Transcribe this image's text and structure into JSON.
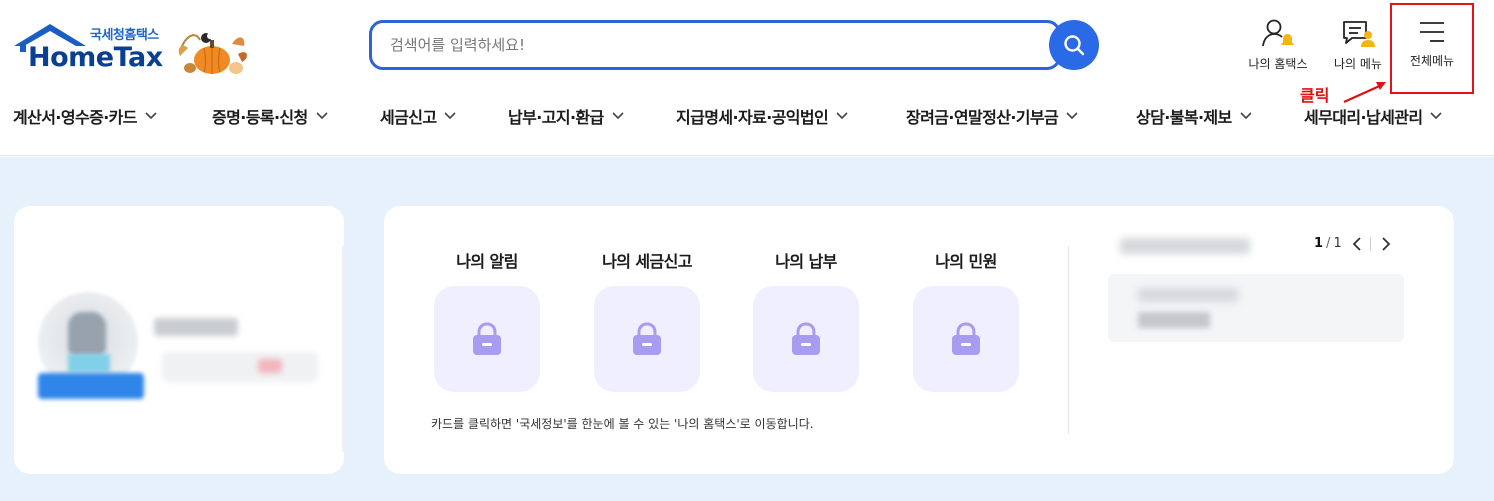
{
  "header": {
    "logo_kr": "국세청홈택스",
    "logo_en": "HomeTax",
    "search_placeholder": "검색어를 입력하세요!",
    "util": {
      "my_hometax": "나의 홈택스",
      "my_menu": "나의 메뉴",
      "all_menu": "전체메뉴"
    },
    "annotation": "클릭",
    "annotation_color": "#e01010"
  },
  "gnb": [
    {
      "label": "계산서·영수증·카드"
    },
    {
      "label": "증명·등록·신청"
    },
    {
      "label": "세금신고"
    },
    {
      "label": "납부·고지·환급"
    },
    {
      "label": "지급명세·자료·공익법인"
    },
    {
      "label": "장려금·연말정산·기부금"
    },
    {
      "label": "상담·불복·제보"
    },
    {
      "label": "세무대리·납세관리"
    }
  ],
  "my_section": {
    "tiles": [
      {
        "label": "나의 알림",
        "icon": "lock-icon"
      },
      {
        "label": "나의 세금신고",
        "icon": "lock-icon"
      },
      {
        "label": "나의 납부",
        "icon": "lock-icon"
      },
      {
        "label": "나의 민원",
        "icon": "lock-icon"
      }
    ],
    "note": "카드를 클릭하면 '국세정보'를 한눈에 볼 수 있는 '나의 홈택스'로 이동합니다.",
    "pager": {
      "current": "1",
      "separator": "/",
      "total": "1"
    }
  },
  "colors": {
    "brand_blue": "#2b63d9",
    "logo_navy": "#0b3f91",
    "lock_purple": "#a89cf0",
    "tile_bg": "#f0efff",
    "page_bg": "#e6f1fb",
    "highlight_red": "#e5121a"
  }
}
